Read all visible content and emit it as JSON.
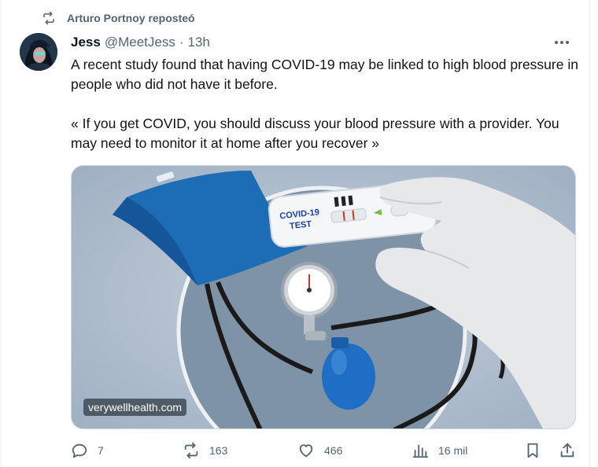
{
  "repost": {
    "label": "Arturo Portnoy reposteó",
    "icon": "repost-icon"
  },
  "author": {
    "name": "Jess",
    "handle": "@MeetJess",
    "separator": "·",
    "time": "13h"
  },
  "tweet": {
    "paragraphs": [
      "A recent study found that having COVID-19 may be linked to high blood pressure in people who did not have it before.",
      "« If you get COVID, you should discuss your blood pressure with a provider. You may need to monitor it at home after you recover »"
    ]
  },
  "media": {
    "test_label_line1": "COVID-19",
    "test_label_line2": "TEST",
    "source": "verywellhealth.com"
  },
  "actions": {
    "replies": "7",
    "reposts": "163",
    "likes": "466",
    "views": "16 mil"
  },
  "colors": {
    "text": "#0f1419",
    "secondary": "#536471",
    "cuff_blue": "#1c6db5",
    "background": "#ffffff"
  }
}
